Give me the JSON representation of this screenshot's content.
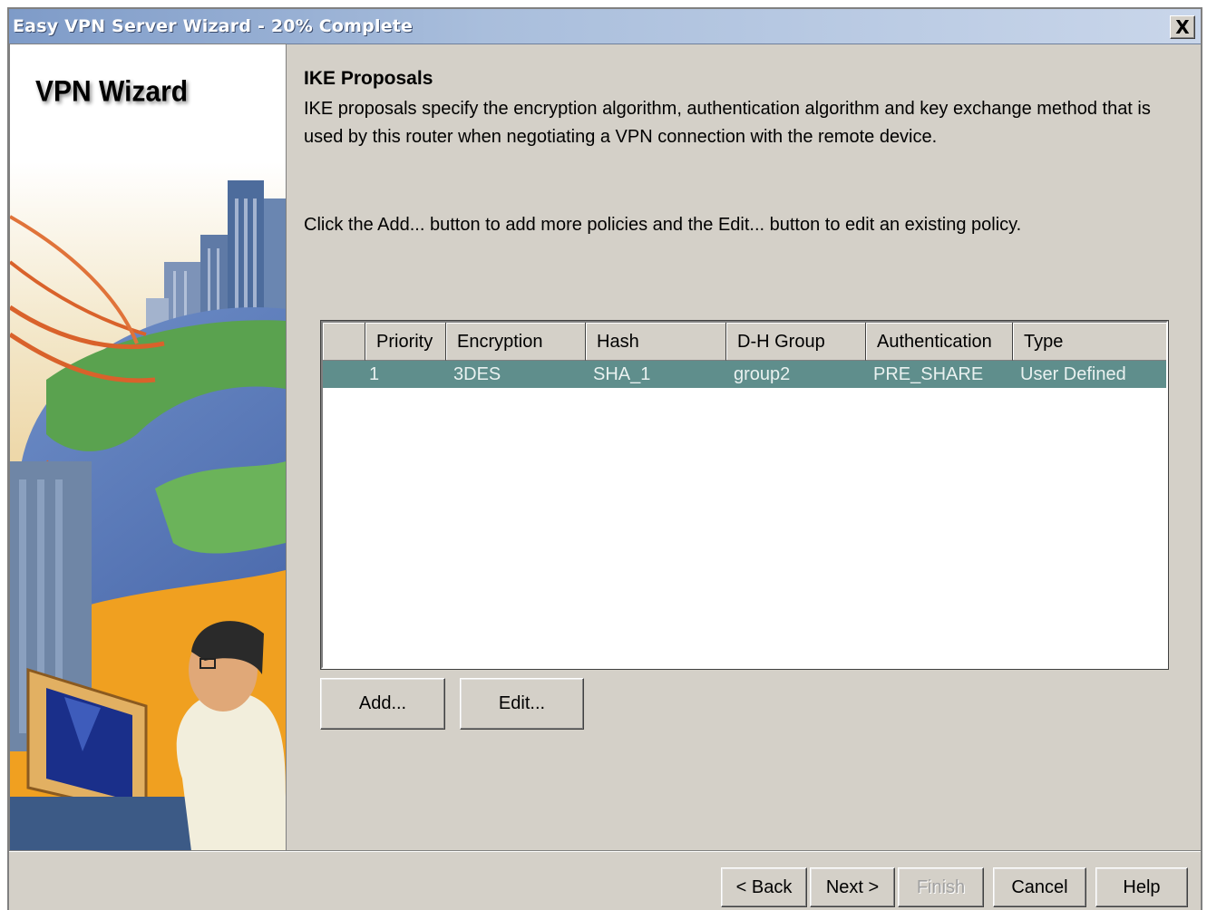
{
  "window": {
    "title": "Easy VPN Server Wizard - 20% Complete",
    "close_label": "X"
  },
  "side_panel": {
    "title": "VPN Wizard"
  },
  "content": {
    "heading": "IKE Proposals",
    "description": "IKE proposals specify the encryption algorithm, authentication algorithm and key exchange method that is used by this router when negotiating a VPN connection with the remote device.",
    "instruction": "Click the Add... button to add more policies and the Edit... button to edit an existing policy."
  },
  "table": {
    "columns": [
      "",
      "Priority",
      "Encryption",
      "Hash",
      "D-H Group",
      "Authentication",
      "Type"
    ],
    "rows": [
      {
        "marker": "",
        "priority": "1",
        "encryption": "3DES",
        "hash": "SHA_1",
        "dh_group": "group2",
        "authentication": "PRE_SHARE",
        "type": "User Defined"
      }
    ],
    "selected_row_color": "#5f8e8c"
  },
  "actions": {
    "add_label": "Add...",
    "edit_label": "Edit..."
  },
  "footer": {
    "back_label": "< Back",
    "next_label": "Next >",
    "finish_label": "Finish",
    "cancel_label": "Cancel",
    "help_label": "Help"
  },
  "colors": {
    "dialog_background": "#d4d0c8",
    "title_bar": "#7e9bc8",
    "selection": "#5f8e8c"
  },
  "icons": {
    "close": "close-icon",
    "wizard_illustration": "vpn-wizard-illustration"
  }
}
